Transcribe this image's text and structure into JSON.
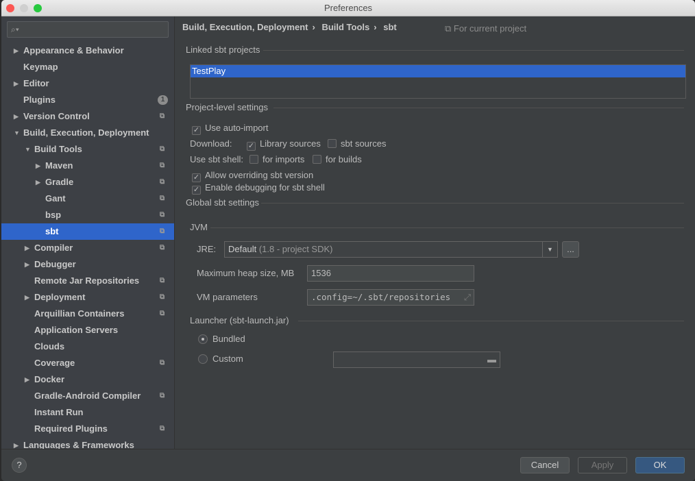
{
  "window": {
    "title": "Preferences"
  },
  "search": {
    "placeholder": ""
  },
  "tree": [
    {
      "label": "Appearance & Behavior",
      "level": 0,
      "arrow": "right"
    },
    {
      "label": "Keymap",
      "level": 0
    },
    {
      "label": "Editor",
      "level": 0,
      "arrow": "right"
    },
    {
      "label": "Plugins",
      "level": 0,
      "badge": "1"
    },
    {
      "label": "Version Control",
      "level": 0,
      "arrow": "right",
      "proj": true
    },
    {
      "label": "Build, Execution, Deployment",
      "level": 0,
      "arrow": "down"
    },
    {
      "label": "Build Tools",
      "level": 1,
      "arrow": "down",
      "proj": true
    },
    {
      "label": "Maven",
      "level": 2,
      "arrow": "right",
      "proj": true
    },
    {
      "label": "Gradle",
      "level": 2,
      "arrow": "right",
      "proj": true
    },
    {
      "label": "Gant",
      "level": 2,
      "proj": true
    },
    {
      "label": "bsp",
      "level": 2,
      "proj": true
    },
    {
      "label": "sbt",
      "level": 2,
      "proj": true,
      "selected": true
    },
    {
      "label": "Compiler",
      "level": 1,
      "arrow": "right",
      "proj": true
    },
    {
      "label": "Debugger",
      "level": 1,
      "arrow": "right"
    },
    {
      "label": "Remote Jar Repositories",
      "level": 1,
      "proj": true
    },
    {
      "label": "Deployment",
      "level": 1,
      "arrow": "right",
      "proj": true
    },
    {
      "label": "Arquillian Containers",
      "level": 1,
      "proj": true
    },
    {
      "label": "Application Servers",
      "level": 1
    },
    {
      "label": "Clouds",
      "level": 1
    },
    {
      "label": "Coverage",
      "level": 1,
      "proj": true
    },
    {
      "label": "Docker",
      "level": 1,
      "arrow": "right"
    },
    {
      "label": "Gradle-Android Compiler",
      "level": 1,
      "proj": true
    },
    {
      "label": "Instant Run",
      "level": 1
    },
    {
      "label": "Required Plugins",
      "level": 1,
      "proj": true
    },
    {
      "label": "Languages & Frameworks",
      "level": 0,
      "arrow": "right"
    }
  ],
  "breadcrumb": [
    "Build, Execution, Deployment",
    "Build Tools",
    "sbt"
  ],
  "breadcrumb_sep": "›",
  "for_current_project": "For current project",
  "linked": {
    "title": "Linked sbt projects",
    "items": [
      "TestPlay"
    ]
  },
  "project_settings": {
    "title": "Project-level settings",
    "auto_import": "Use auto-import",
    "download_label": "Download:",
    "library_sources": "Library sources",
    "sbt_sources": "sbt sources",
    "use_shell_label": "Use sbt shell:",
    "for_imports": "for imports",
    "for_builds": "for builds",
    "allow_override": "Allow overriding sbt version",
    "enable_debug": "Enable debugging for sbt shell"
  },
  "global": {
    "title": "Global sbt settings",
    "jvm": "JVM",
    "jre_label": "JRE:",
    "jre_value": "Default",
    "jre_detail": "(1.8 - project SDK)",
    "browse": "...",
    "heap_label": "Maximum heap size, MB",
    "heap_value": "1536",
    "vm_label": "VM parameters",
    "vm_value": ".config=~/.sbt/repositories",
    "launcher": "Launcher (sbt-launch.jar)",
    "bundled": "Bundled",
    "custom": "Custom",
    "custom_path": ""
  },
  "footer": {
    "help": "?",
    "cancel": "Cancel",
    "apply": "Apply",
    "ok": "OK"
  },
  "colors": {
    "selection": "#2f65ca",
    "ok_button": "#365880"
  }
}
